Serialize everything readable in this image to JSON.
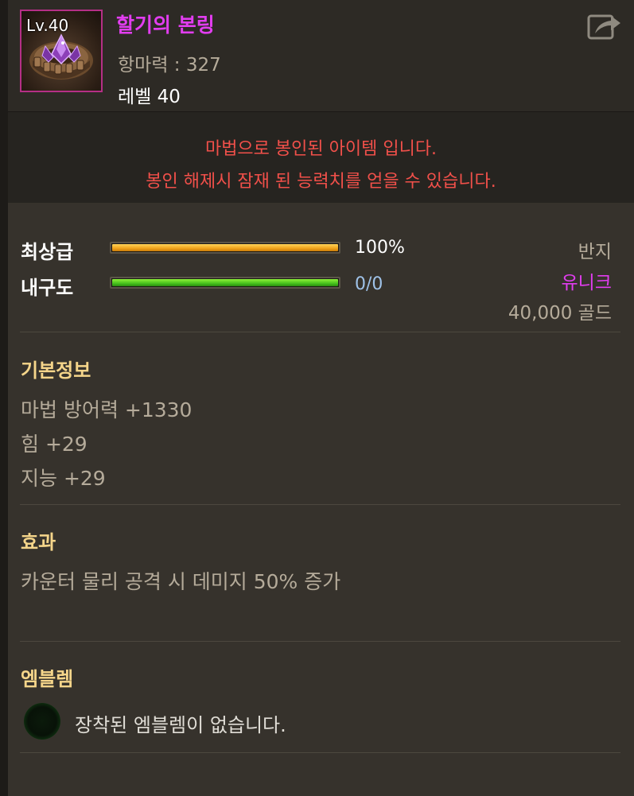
{
  "item": {
    "level_badge": "Lv.40",
    "name": "할기의 본링",
    "power": "항마력 : 327",
    "level": "레벨 40",
    "name_color": "#e23df0",
    "frame_color": "#b52f86"
  },
  "seal": {
    "line1": "마법으로 봉인된 아이템 입니다.",
    "line2": "봉인 해제시 잠재 된 능력치를 얻을 수 있습니다."
  },
  "stats": {
    "quality_label": "최상급",
    "quality_value": "100%",
    "quality_fraction": 1.0,
    "durability_label": "내구도",
    "durability_value": "0/0",
    "durability_fraction": 1.0
  },
  "info": {
    "type": "반지",
    "rarity": "유니크",
    "rarity_color": "#e23df0",
    "price": "40,000 골드"
  },
  "basic": {
    "title": "기본정보",
    "lines": [
      "마법 방어력 +1330",
      "힘 +29",
      "지능 +29"
    ]
  },
  "effect": {
    "title": "효과",
    "lines": [
      "카운터 물리 공격 시 데미지 50% 증가"
    ]
  },
  "emblem": {
    "title": "엠블렘",
    "empty_text": "장착된 엠블렘이 없습니다."
  },
  "icons": {
    "share": "share-icon",
    "emblem_slot": "emblem-slot-icon"
  }
}
